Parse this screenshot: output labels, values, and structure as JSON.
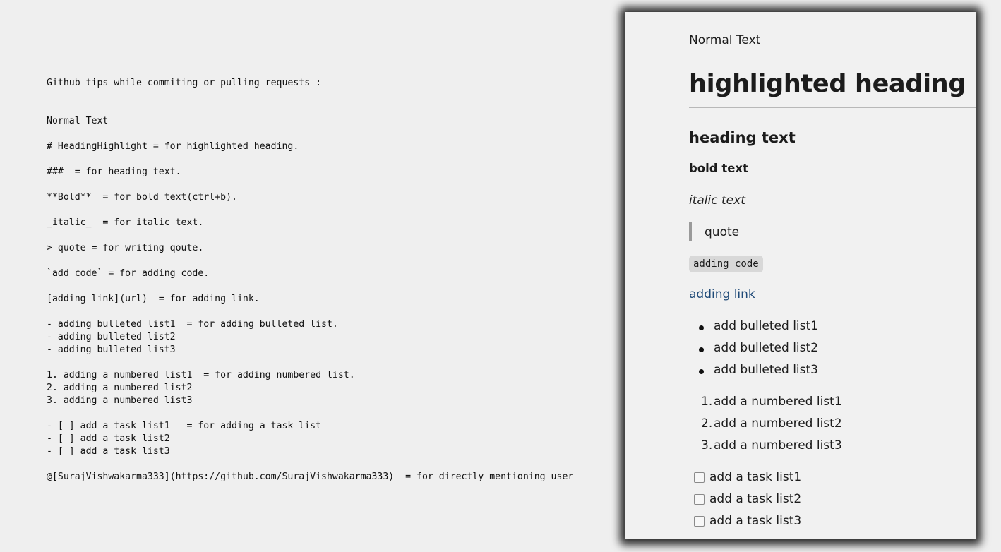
{
  "source": {
    "header": "Github tips while commiting or pulling requests :",
    "lines": {
      "normal": "Normal Text",
      "heading_highlight": "# HeadingHighlight = for highlighted heading.",
      "heading": "###  = for heading text.",
      "bold": "**Bold**  = for bold text(ctrl+b).",
      "italic": "_italic_  = for italic text.",
      "quote": "> quote = for writing qoute.",
      "code": "`add code` = for adding code.",
      "link": "[adding link](url)  = for adding link.",
      "bullets": [
        "- adding bulleted list1  = for adding bulleted list.",
        "- adding bulleted list2",
        "- adding bulleted list3"
      ],
      "numbered": [
        "1. adding a numbered list1  = for adding numbered list.",
        "2. adding a numbered list2",
        "3. adding a numbered list3"
      ],
      "tasks": [
        "- [ ] add a task list1   = for adding a task list",
        "- [ ] add a task list2",
        "- [ ] add a task list3"
      ],
      "mention": "@[SurajVishwakarma333](https://github.com/SurajVishwakarma333)  = for directly mentioning user"
    }
  },
  "preview": {
    "normal_text": "Normal Text",
    "highlighted_heading": "highlighted heading",
    "heading_text": "heading text",
    "bold_text": "bold text",
    "italic_text": "italic text",
    "quote": "quote",
    "code": "adding code",
    "link": "adding link",
    "bulleted": [
      "add bulleted list1",
      "add bulleted list2",
      "add bulleted list3"
    ],
    "numbered_indices": [
      "1.",
      "2.",
      "3."
    ],
    "numbered": [
      "add a numbered list1",
      "add a numbered list2",
      "add a numbered list3"
    ],
    "tasks": [
      "add a task list1",
      "add a task list2",
      "add a task list3"
    ],
    "link_color": "#1f4a78"
  }
}
